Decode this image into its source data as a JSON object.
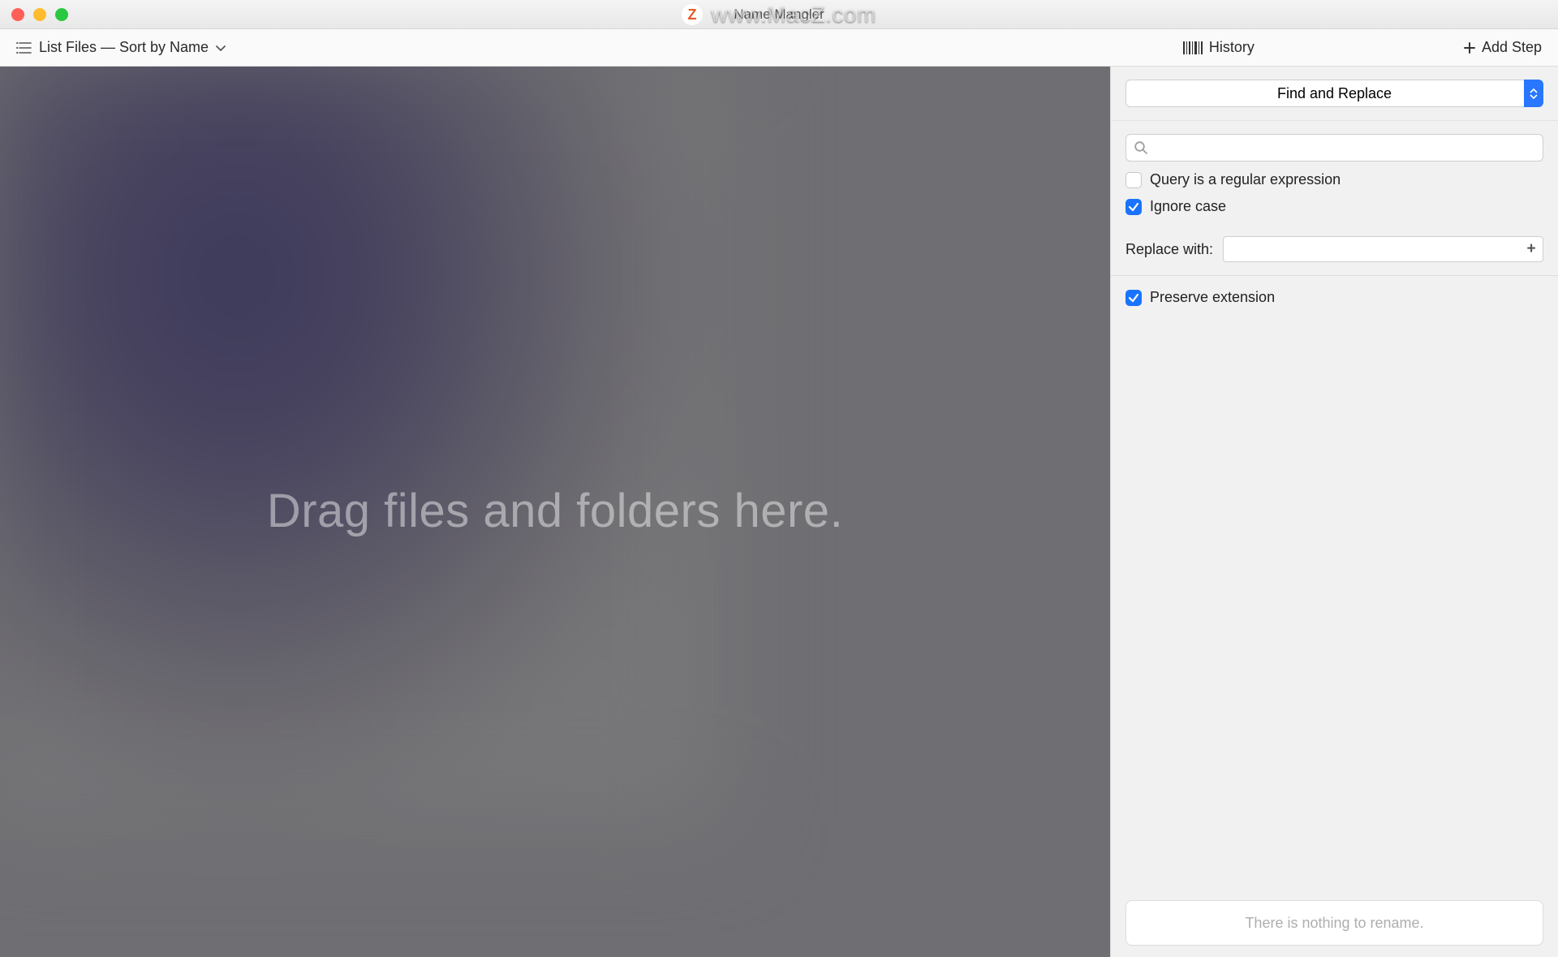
{
  "window": {
    "title": "Name Mangler"
  },
  "watermark": {
    "logo_letter": "Z",
    "text": "www.MacZ.com"
  },
  "toolbar": {
    "list_files_label": "List Files — Sort by Name",
    "history_label": "History",
    "add_step_label": "Add Step"
  },
  "dropzone": {
    "hint": "Drag files and folders here."
  },
  "step": {
    "action_selected": "Find and Replace",
    "search_value": "",
    "search_placeholder": "",
    "regex_label": "Query is a regular expression",
    "regex_checked": false,
    "ignore_case_label": "Ignore case",
    "ignore_case_checked": true,
    "replace_with_label": "Replace with:",
    "replace_value": "",
    "preserve_ext_label": "Preserve extension",
    "preserve_ext_checked": true
  },
  "rename_button": {
    "label": "There is nothing to rename."
  }
}
